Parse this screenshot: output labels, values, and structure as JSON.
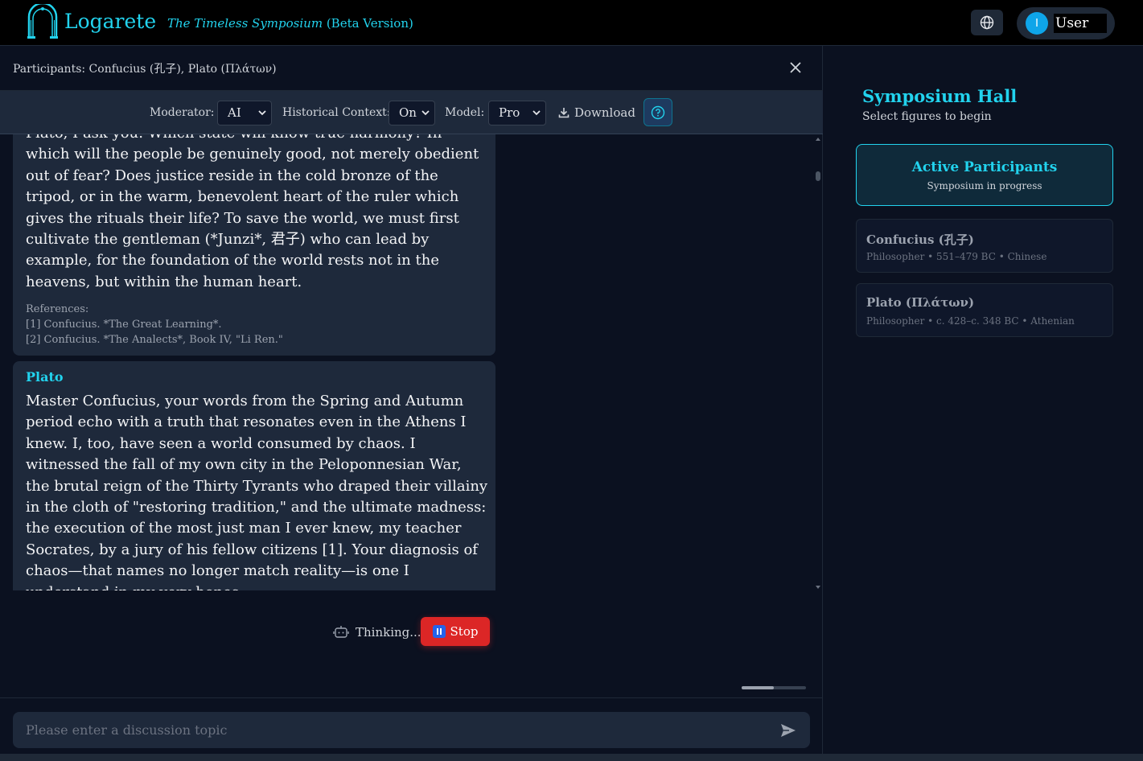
{
  "header": {
    "brand": "Logarete",
    "tagline_italic": "The Timeless Symposium",
    "tagline_suffix": " (Beta Version)",
    "user_initial": "I",
    "user_name": "User"
  },
  "chat": {
    "participants": "Participants: Confucius (孔子), Plato (Πλάτων)",
    "controls": {
      "moderator_label": "Moderator:",
      "moderator_value": "AI",
      "context_label": "Historical Context:",
      "context_value": "On",
      "model_label": "Model:",
      "model_value": "Pro",
      "download_label": "Download"
    },
    "messages": [
      {
        "speaker": "",
        "text": "Plato, I ask you: Which state will know true harmony? In which will the people be genuinely good, not merely obedient out of fear? Does justice reside in the cold bronze of the tripod, or in the warm, benevolent heart of the ruler which gives the rituals their life? To save the world, we must first cultivate the gentleman (*Junzi*, 君子) who can lead by example, for the foundation of the world rests not in the heavens, but within the human heart.",
        "references_title": "References:",
        "references": [
          "[1] Confucius. *The Great Learning*.",
          "[2] Confucius. *The Analects*, Book IV, \"Li Ren.\""
        ]
      },
      {
        "speaker": "Plato",
        "text": "Master Confucius, your words from the Spring and Autumn period echo with a truth that resonates even in the Athens I knew. I, too, have seen a world consumed by chaos. I witnessed the fall of my own city in the Peloponnesian War, the brutal reign of the Thirty Tyrants who draped their villainy in the cloth of \"restoring tradition,\" and the ultimate madness: the execution of the most just man I ever knew, my teacher Socrates, by a jury of his fellow citizens [1]. Your diagnosis of chaos—that names no longer match reality—is one I understand in my very bones.\nYou have presented me with a choice between a state of perfect"
      }
    ],
    "status": {
      "thinking": "Thinking...",
      "stop": "Stop"
    },
    "input_placeholder": "Please enter a discussion topic"
  },
  "sidebar": {
    "title": "Symposium Hall",
    "subtitle": "Select figures to begin",
    "active_title": "Active Participants",
    "active_subtitle": "Symposium in progress",
    "figures": [
      {
        "name": "Confucius (孔子)",
        "meta": "Philosopher • 551–479 BC • Chinese"
      },
      {
        "name": "Plato (Πλάτων)",
        "meta": "Philosopher • c. 428–c. 348 BC • Athenian"
      }
    ]
  },
  "colors": {
    "accent": "#22d3ee",
    "background": "#0b1120",
    "card": "#1e293b",
    "stop": "#dc2626"
  },
  "icons": [
    "arch-logo-icon",
    "globe-icon",
    "close-icon",
    "chevron-down-icon",
    "download-icon",
    "help-icon",
    "robot-icon",
    "pause-icon",
    "send-icon"
  ]
}
